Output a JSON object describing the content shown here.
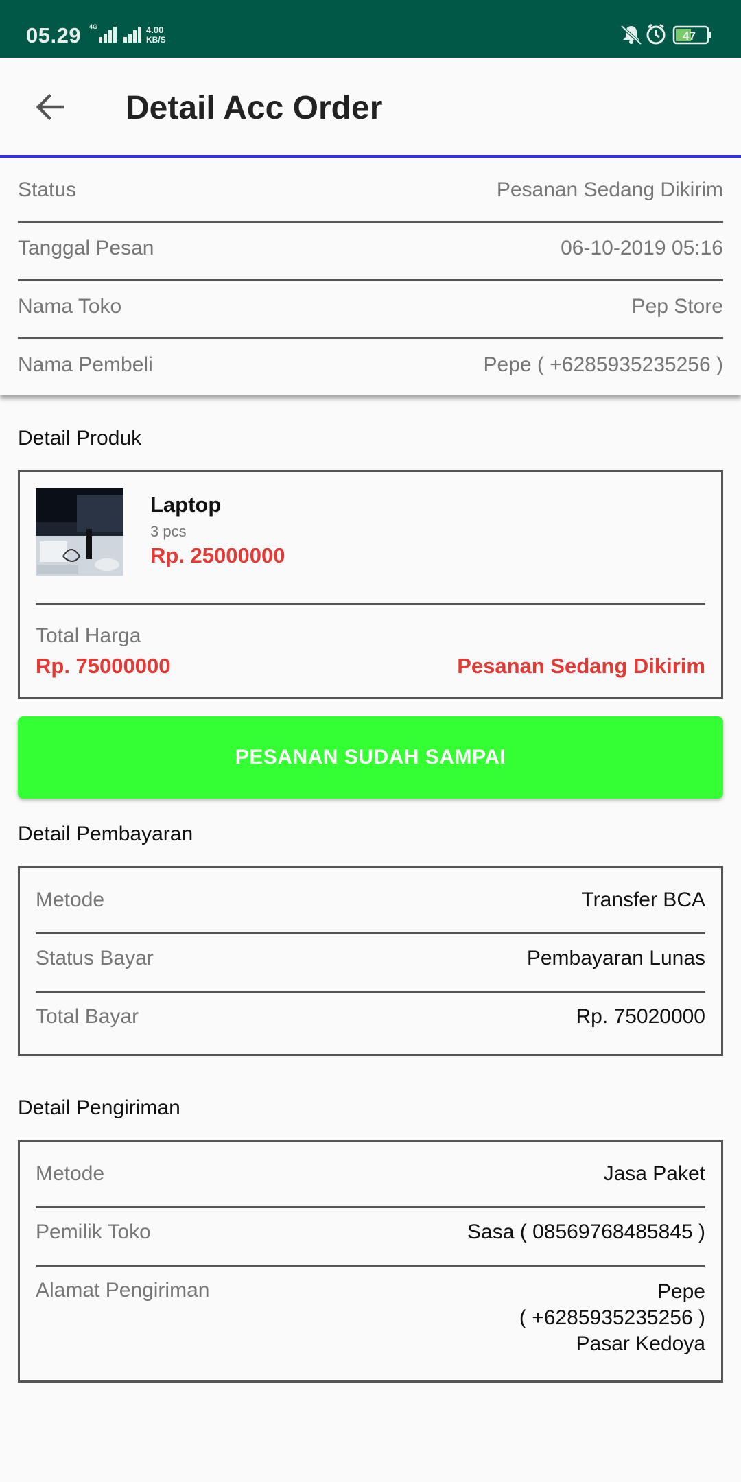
{
  "status_bar": {
    "time": "05.29",
    "network": "4G",
    "speed_value": "4.00",
    "speed_unit": "KB/S",
    "battery": "47"
  },
  "appbar": {
    "title": "Detail Acc Order"
  },
  "order_info": [
    {
      "label": "Status",
      "value": "Pesanan Sedang Dikirim"
    },
    {
      "label": "Tanggal Pesan",
      "value": "06-10-2019 05:16"
    },
    {
      "label": "Nama Toko",
      "value": "Pep Store"
    },
    {
      "label": "Nama Pembeli",
      "value": "Pepe ( +6285935235256 )"
    }
  ],
  "product_section": {
    "title": "Detail Produk",
    "product": {
      "name": "Laptop",
      "qty": "3 pcs",
      "price": "Rp. 25000000"
    },
    "total_label": "Total Harga",
    "total_value": "Rp. 75000000",
    "status": "Pesanan Sedang Dikirim"
  },
  "action_button": {
    "label": "PESANAN SUDAH SAMPAI"
  },
  "payment": {
    "title": "Detail Pembayaran",
    "rows": [
      {
        "label": "Metode",
        "value": "Transfer BCA"
      },
      {
        "label": "Status Bayar",
        "value": "Pembayaran Lunas"
      },
      {
        "label": "Total Bayar",
        "value": "Rp. 75020000"
      }
    ]
  },
  "shipping": {
    "title": "Detail Pengiriman",
    "rows": [
      {
        "label": "Metode",
        "value": "Jasa Paket"
      },
      {
        "label": "Pemilik Toko",
        "value": "Sasa ( 08569768485845 )"
      }
    ],
    "address_label": "Alamat Pengiriman",
    "address_lines": [
      "Pepe",
      "( +6285935235256 )",
      "Pasar Kedoya"
    ]
  },
  "colors": {
    "status_bar": "#015847",
    "accent_line": "#3333e6",
    "price_red": "#e53935",
    "button_green": "#33ff33"
  }
}
